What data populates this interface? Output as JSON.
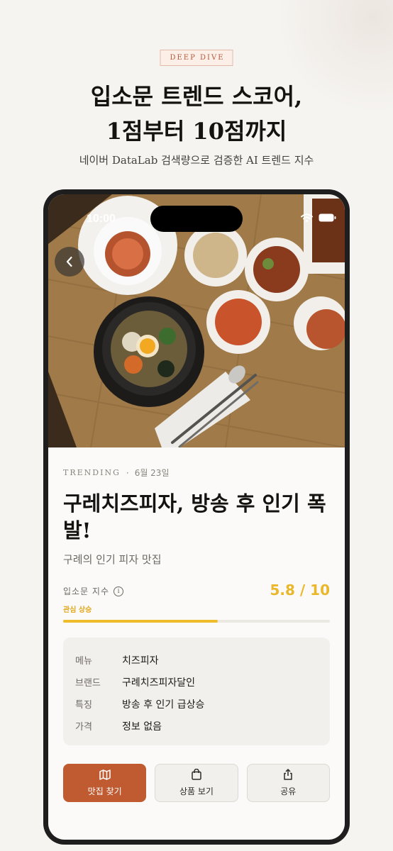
{
  "page": {
    "badge": "DEEP DIVE",
    "headline_line1": "입소문 트렌드 스코어,",
    "headline_line2": "1점부터 10점까지",
    "subtitle": "네이버 DataLab 검색량으로 검증한 AI 트렌드 지수"
  },
  "status_bar": {
    "time": "10:00"
  },
  "article": {
    "category": "TRENDING",
    "separator": "·",
    "date": "6월 23일",
    "title": "구레치즈피자, 방송 후 인기 폭발!",
    "description": "구례의 인기 피자 맛집",
    "score_label": "입소문 지수",
    "info_icon_glyph": "i",
    "score_text": "5.8 / 10",
    "score_value": 5.8,
    "score_max": 10,
    "score_status": "관심 상승",
    "details": [
      {
        "key": "메뉴",
        "value": "치즈피자"
      },
      {
        "key": "브랜드",
        "value": "구례치즈피자달인"
      },
      {
        "key": "특징",
        "value": "방송 후 인기 급상승"
      },
      {
        "key": "가격",
        "value": "정보 없음"
      }
    ]
  },
  "actions": {
    "find_restaurant": "맛집 찾기",
    "view_product": "상품 보기",
    "share": "공유"
  },
  "icons": {
    "back": "chevron-left-icon",
    "map": "map-icon",
    "bag": "shopping-bag-icon",
    "share": "share-icon",
    "wifi": "wifi-icon",
    "battery": "battery-icon"
  },
  "colors": {
    "accent": "#c05a30",
    "score": "#eab72b",
    "badge_text": "#b8573a"
  }
}
